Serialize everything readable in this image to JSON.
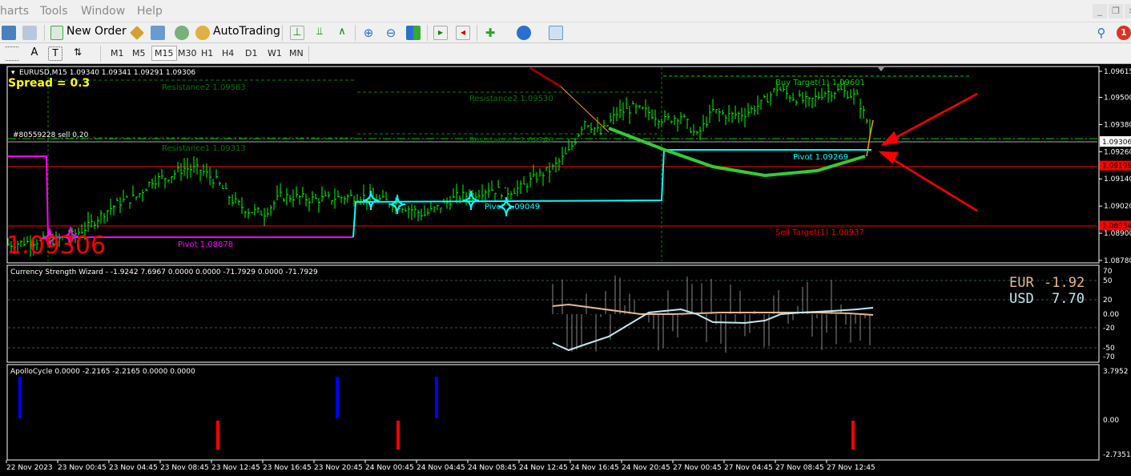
{
  "menu": [
    "harts",
    "Tools",
    "Window",
    "Help"
  ],
  "toolbar": {
    "new_order": "New Order",
    "autotrading": "AutoTrading",
    "notification_count": "1"
  },
  "timeframes": [
    "M1",
    "M5",
    "M15",
    "M30",
    "H1",
    "H4",
    "D1",
    "W1",
    "MN"
  ],
  "selected_timeframe": "M15",
  "chart": {
    "header": "EURUSD,M15  1.09340 1.09341 1.09291 1.09306",
    "spread": "Spread = 0.3",
    "order_label": "#80559228 sell 0.20",
    "big_price": "1.09306",
    "labels": {
      "res2_a": "Resistance2 1.09583",
      "res2_b": "Resistance2 1.09530",
      "res1_a": "Resistance1 1.09313",
      "res1_b": "Resistance1 1.09346",
      "pivot_a": "Pivot 1.08878",
      "pivot_b": "Pivot 1.09049",
      "pivot_c": "Pivot 1.09269",
      "buy_target": "Buy Target(1) 1.09601",
      "sell_target": "Sell Target(1) 1.08937"
    },
    "price_axis": [
      "1.09615",
      "1.09500",
      "1.09380",
      "1.09260",
      "1.09140",
      "1.09020",
      "1.08900",
      "1.08780"
    ],
    "price_axis_values": [
      1.09615,
      1.095,
      1.0938,
      1.0926,
      1.0914,
      1.0902,
      1.089,
      1.0878
    ],
    "current_price": "1.09306",
    "line_prices": [
      {
        "label": "1.09199",
        "value": 1.09199
      },
      {
        "label": "1.08934",
        "value": 1.08934
      }
    ],
    "closes": [
      1.08851,
      1.0886,
      1.08866,
      1.0887,
      1.0889,
      1.0893,
      1.08992,
      1.09038,
      1.0906,
      1.09134,
      1.0915,
      1.09187,
      1.0918,
      1.0913,
      1.09045,
      1.09,
      1.0899,
      1.09063,
      1.0906,
      1.0905,
      1.09052,
      1.0906,
      1.09063,
      1.0905,
      1.09035,
      1.0901,
      1.08982,
      1.0902,
      1.0906,
      1.0907,
      1.09098,
      1.09081,
      1.091,
      1.0915,
      1.09187,
      1.09258,
      1.09399,
      1.0934,
      1.0943,
      1.09452,
      1.09434,
      1.09399,
      1.0942,
      1.09328,
      1.0944,
      1.0942,
      1.0943,
      1.0947,
      1.09541,
      1.095,
      1.0948,
      1.09523,
      1.0953,
      1.095,
      1.09328
    ],
    "colors": {
      "bars": "#00ff00",
      "pivot1": "#ff00ff",
      "pivot2": "#00ffff",
      "red_line": "#ff0000",
      "levels": "#008000",
      "spread": "#ffff00"
    }
  },
  "csw": {
    "header": "Currency Strength Wizard -  -1.9242 7.6967 0.0000 0.0000 -71.7929 0.0000 -71.7929",
    "eur_label": "EUR",
    "eur_value": "-1.92",
    "usd_label": "USD",
    "usd_value": "7.70",
    "axis": [
      "70",
      "50",
      "20",
      "0.00",
      "-20",
      "-50",
      "-70"
    ]
  },
  "apollo": {
    "header": "ApolloCycle 0.0000 -2.2165 -2.2165 0.0000 0.0000",
    "axis": [
      "3.7952",
      "0.00",
      "-2.7351"
    ]
  },
  "time_axis": [
    "22 Nov 2023",
    "23 Nov 00:45",
    "23 Nov 04:45",
    "23 Nov 08:45",
    "23 Nov 12:45",
    "23 Nov 16:45",
    "23 Nov 20:45",
    "24 Nov 00:45",
    "24 Nov 04:45",
    "24 Nov 08:45",
    "24 Nov 12:45",
    "24 Nov 16:45",
    "24 Nov 20:45",
    "27 Nov 00:45",
    "27 Nov 04:45",
    "27 Nov 08:45",
    "27 Nov 12:45"
  ]
}
